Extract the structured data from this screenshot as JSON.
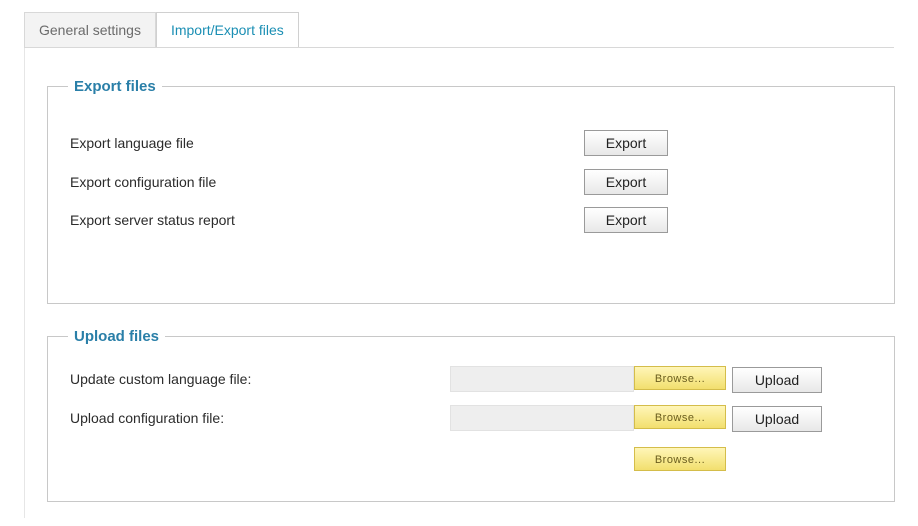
{
  "tabs": [
    {
      "label": "General settings",
      "active": false
    },
    {
      "label": "Import/Export files",
      "active": true
    }
  ],
  "export_section": {
    "title": "Export files",
    "rows": [
      {
        "label": "Export language file",
        "button": "Export"
      },
      {
        "label": "Export configuration file",
        "button": "Export"
      },
      {
        "label": "Export server status report",
        "button": "Export"
      }
    ]
  },
  "upload_section": {
    "title": "Upload files",
    "rows": [
      {
        "label": "Update custom language file:",
        "browse": "Browse...",
        "button": "Upload"
      },
      {
        "label": "Upload configuration file:",
        "browse": "Browse...",
        "button": "Upload"
      }
    ],
    "extra_browse": "Browse..."
  },
  "colors": {
    "tab_active_text": "#1b8fb4",
    "legend_text": "#2a7fa8",
    "browse_bg": "#f2df6e"
  }
}
